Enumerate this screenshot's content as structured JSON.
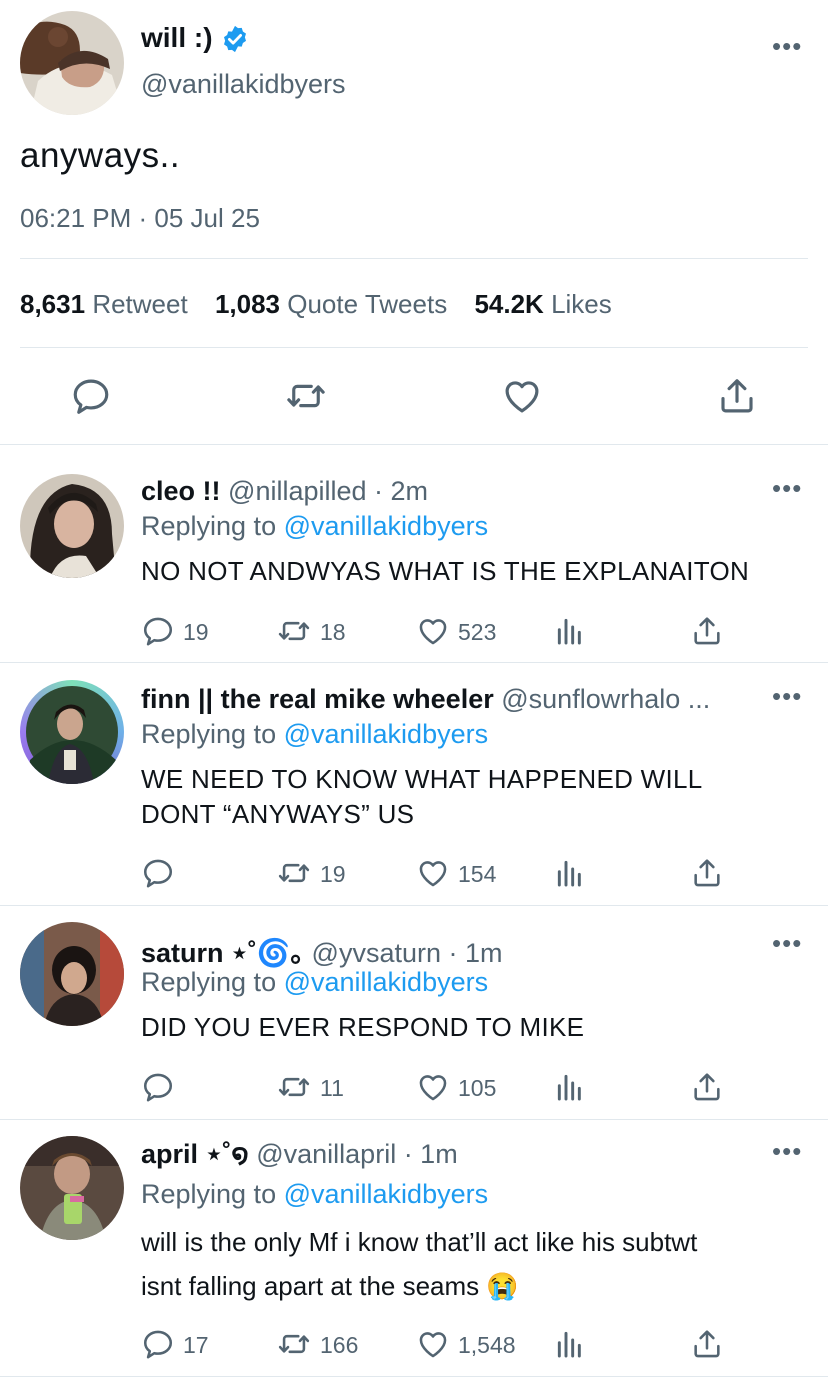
{
  "main_tweet": {
    "display_name": "will :)",
    "handle": "@vanillakidbyers",
    "text": "anyways..",
    "timestamp": "06:21 PM · 05 Jul 25",
    "stats": {
      "retweets_count": "8,631",
      "retweets_label": "Retweet",
      "quotes_count": "1,083",
      "quotes_label": "Quote Tweets",
      "likes_count": "54.2K",
      "likes_label": "Likes"
    },
    "more_label": "•••",
    "colors": {
      "verified": "#1d9bf0",
      "link": "#1d9bf0",
      "muted": "#536471"
    }
  },
  "replies": [
    {
      "name": "cleo !!",
      "meta": "@nillapilled · 2m",
      "replying_prefix": "Replying to",
      "replying_handle": "@vanillakidbyers",
      "text_lines": [
        "NO NOT ANDWYAS WHAT IS THE EXPLANAITON"
      ],
      "reply_count": "19",
      "retweet_count": "18",
      "like_count": "523"
    },
    {
      "name": "finn || the real mike wheeler",
      "meta": "@sunflowrhalo ...",
      "replying_prefix": "Replying to",
      "replying_handle": "@vanillakidbyers",
      "text_lines": [
        "WE NEED TO KNOW WHAT HAPPENED WILL",
        "DONT “ANYWAYS” US"
      ],
      "reply_count": "",
      "retweet_count": "19",
      "like_count": "154"
    },
    {
      "name": "saturn ⋆˚🌀｡",
      "meta": "@yvsaturn · 1m",
      "replying_prefix": "Replying to",
      "replying_handle": "@vanillakidbyers",
      "text_lines": [
        "DID YOU EVER RESPOND TO MIKE"
      ],
      "reply_count": "",
      "retweet_count": "11",
      "like_count": "105"
    },
    {
      "name": "april ⋆˚໑",
      "meta": "@vanillapril · 1m",
      "replying_prefix": "Replying to",
      "replying_handle": "@vanillakidbyers",
      "text_lines": [
        "will is the only Mf i know that’ll act like his subtwt",
        "isnt falling apart at the seams 😭"
      ],
      "reply_count": "17",
      "retweet_count": "166",
      "like_count": "1,548"
    }
  ]
}
